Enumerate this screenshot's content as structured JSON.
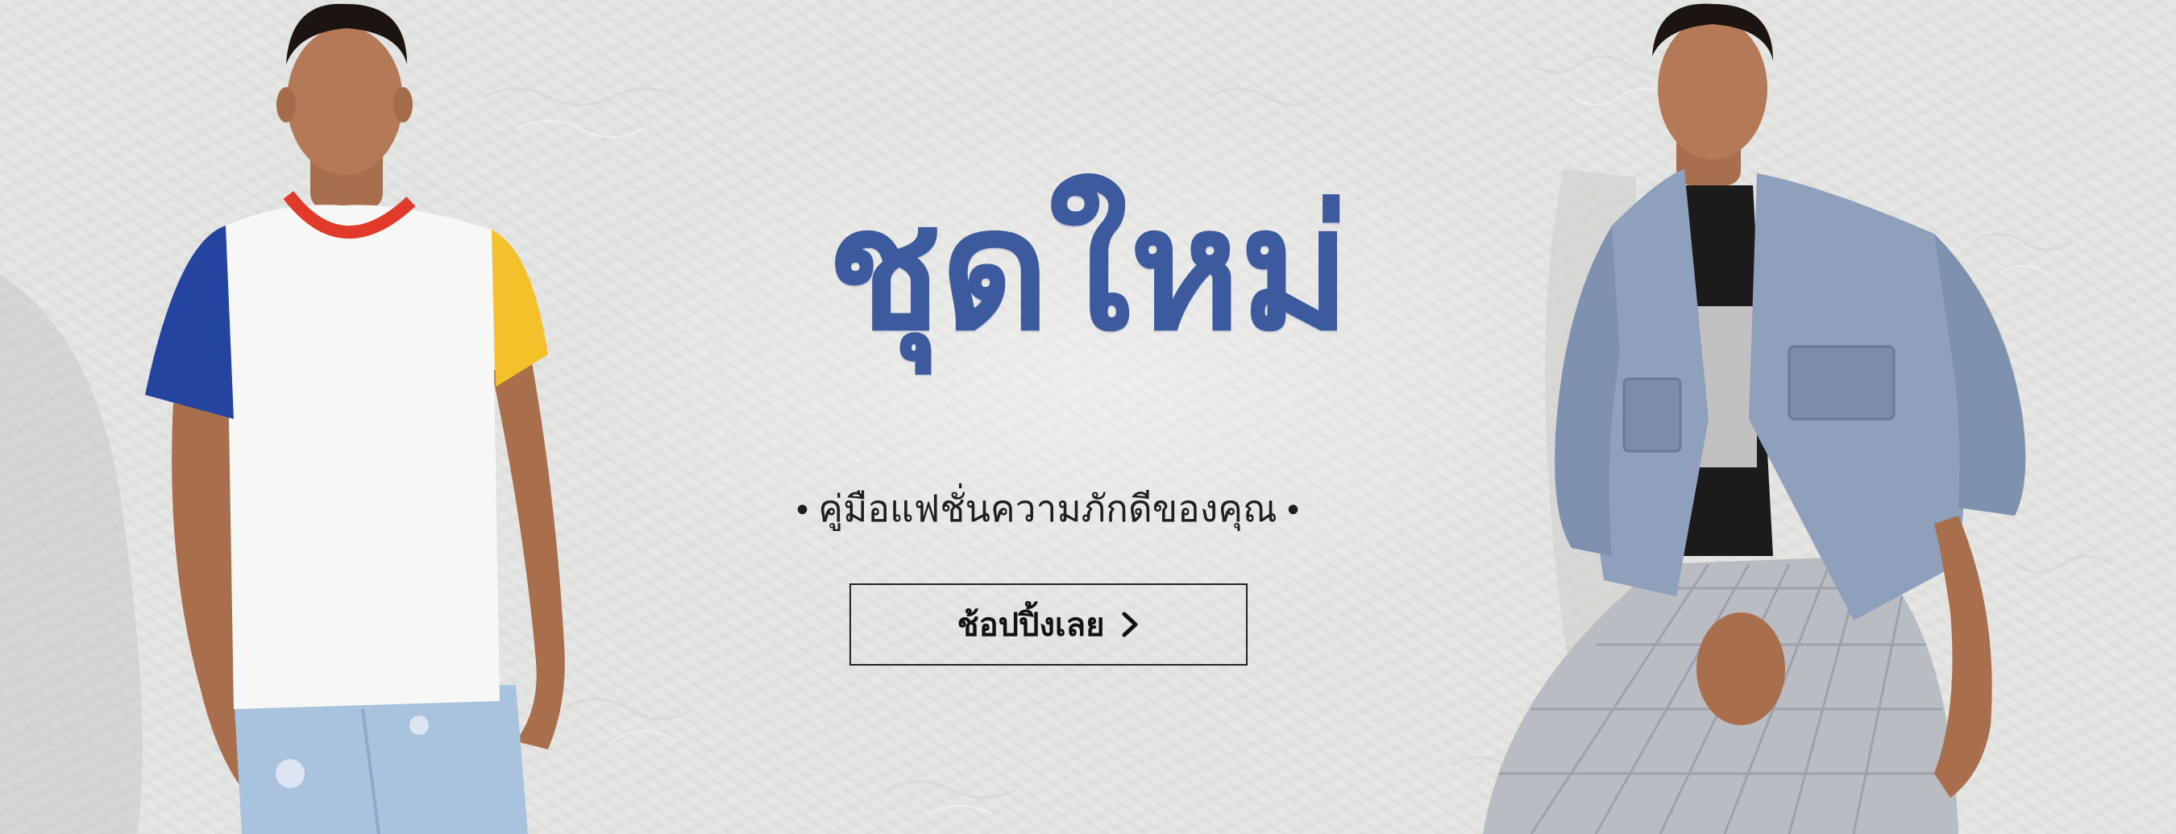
{
  "banner": {
    "headline": "ชุดใหม่",
    "tagline": "คู่มือแฟชั่นความภักดีของคุณ",
    "tagline_bullet": "•",
    "cta_label": "ช้อปปิ้งเลย",
    "cta_icon": "chevron-right-icon"
  },
  "colors": {
    "headline": "#3d5a9e",
    "background": "#e6e6e4",
    "text": "#1e1e1e"
  }
}
